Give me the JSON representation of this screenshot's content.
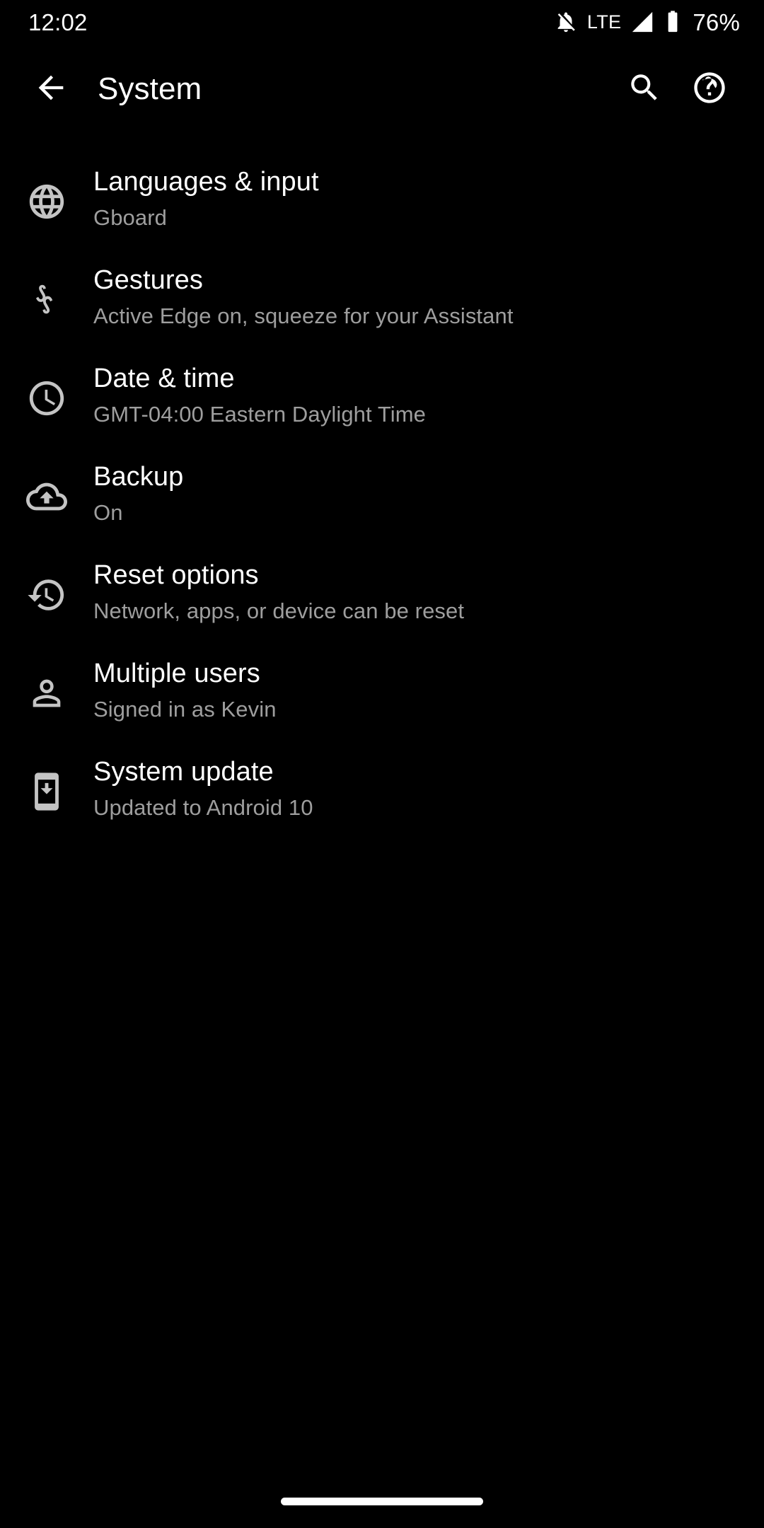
{
  "status_bar": {
    "time": "12:02",
    "notification_icon": "bell-off-icon",
    "network_type": "LTE",
    "signal_icon": "signal-cellular-icon",
    "battery_icon": "battery-icon",
    "battery_level": "76%"
  },
  "app_bar": {
    "back_icon": "arrow-back-icon",
    "title": "System",
    "search_icon": "search-icon",
    "help_icon": "help-icon"
  },
  "settings": {
    "items": [
      {
        "icon": "globe-icon",
        "title": "Languages & input",
        "summary": "Gboard"
      },
      {
        "icon": "gesture-icon",
        "title": "Gestures",
        "summary": "Active Edge on, squeeze for your Assistant"
      },
      {
        "icon": "clock-icon",
        "title": "Date & time",
        "summary": "GMT-04:00 Eastern Daylight Time"
      },
      {
        "icon": "cloud-upload-icon",
        "title": "Backup",
        "summary": "On"
      },
      {
        "icon": "history-restore-icon",
        "title": "Reset options",
        "summary": "Network, apps, or device can be reset"
      },
      {
        "icon": "person-icon",
        "title": "Multiple users",
        "summary": "Signed in as Kevin"
      },
      {
        "icon": "system-update-icon",
        "title": "System update",
        "summary": "Updated to Android 10"
      }
    ]
  },
  "nav_bar": {
    "home_indicator": "home-indicator"
  },
  "colors": {
    "background": "#000000",
    "title_text": "#ffffff",
    "summary_text": "#9e9e9e",
    "icon": "#c4c4c4"
  }
}
